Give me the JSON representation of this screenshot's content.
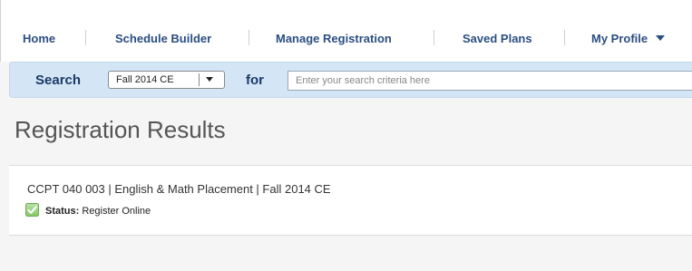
{
  "nav": {
    "items": [
      {
        "label": "Home"
      },
      {
        "label": "Schedule Builder"
      },
      {
        "label": "Manage Registration"
      },
      {
        "label": "Saved Plans"
      },
      {
        "label": "My Profile"
      }
    ]
  },
  "search": {
    "label": "Search",
    "term_value": "Fall 2014 CE",
    "for_label": "for",
    "placeholder": "Enter your search criteria here"
  },
  "page": {
    "title": "Registration Results"
  },
  "result": {
    "title": "CCPT 040 003 | English & Math Placement | Fall 2014 CE",
    "status_label": "Status:",
    "status_value": "Register Online",
    "status_icon": "checkbox-checked-icon",
    "status_color": "#5fb34a"
  }
}
